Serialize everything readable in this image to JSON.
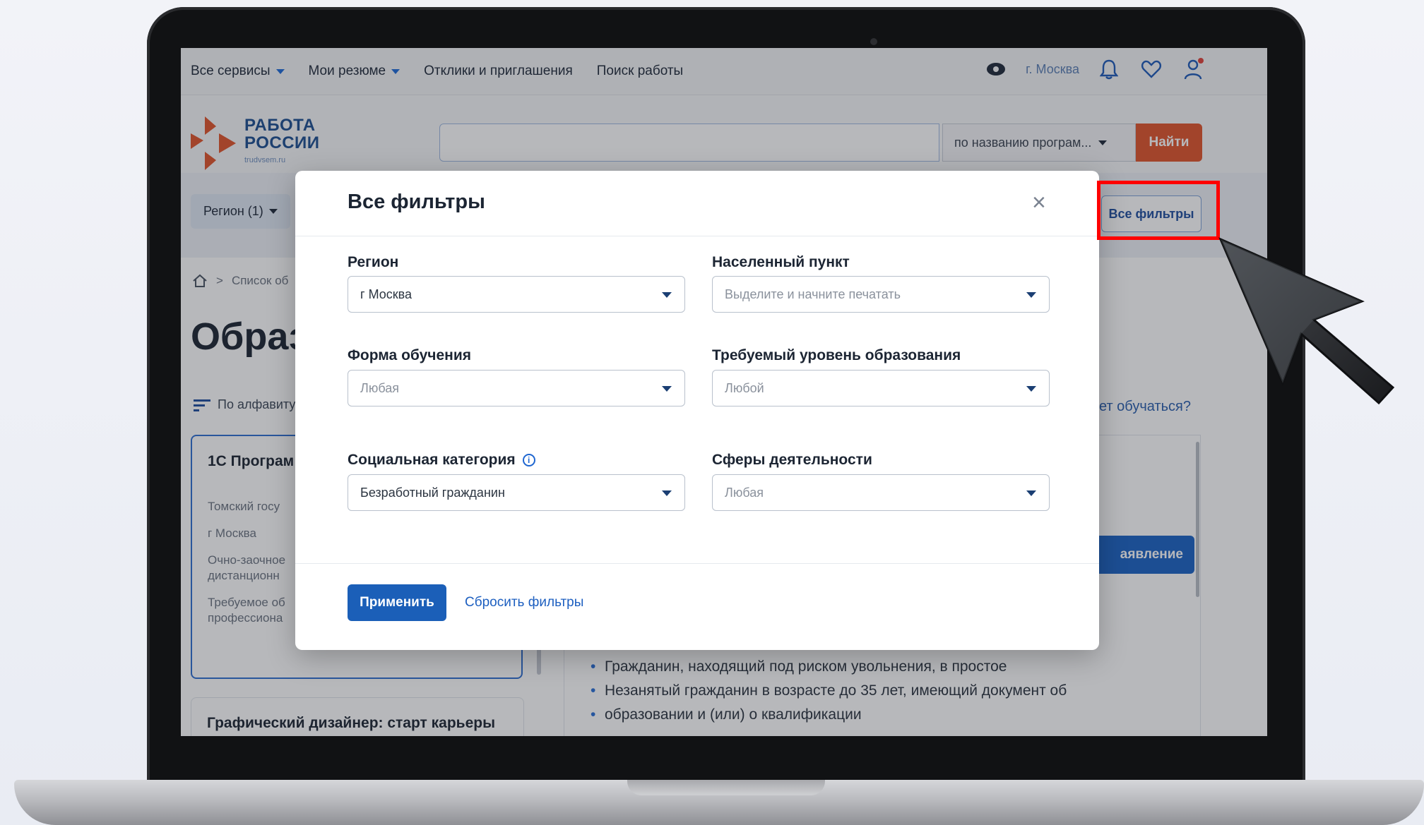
{
  "topbar": {
    "nav": [
      "Все сервисы",
      "Мои резюме",
      "Отклики и приглашения",
      "Поиск работы"
    ],
    "city": "г. Москва"
  },
  "logo": {
    "line1": "РАБОТА",
    "line2": "РОССИИ",
    "domain": "trudvsem.ru"
  },
  "search": {
    "value": "",
    "mode": "по названию програм...",
    "button": "Найти"
  },
  "filters_bar": {
    "region_chip": "Регион (1)",
    "all_filters": "Все фильтры"
  },
  "page": {
    "breadcrumb": "Список об",
    "heading": "Образ",
    "sort": "По алфавиту",
    "question": "ет обучаться?",
    "card1": {
      "title": "1С Програм",
      "lines": [
        "Томский госу",
        "г Москва",
        "Очно-заочное",
        "дистанционн",
        "Требуемое об",
        "профессиона"
      ]
    },
    "card2_title": "Графический дизайнер: старт карьеры",
    "apply_button": "аявление",
    "bullets": [
      "Гражданин, находящий под риском увольнения, в простое",
      "Незанятый гражданин в возрасте до 35 лет, имеющий документ об",
      "образовании и (или) о квалификации"
    ]
  },
  "modal": {
    "title": "Все фильтры",
    "close": "×",
    "fields": {
      "region": {
        "label": "Регион",
        "value": "г Москва"
      },
      "locality": {
        "label": "Населенный пункт",
        "placeholder": "Выделите и начните печатать"
      },
      "study_form": {
        "label": "Форма обучения",
        "placeholder": "Любая"
      },
      "education_level": {
        "label": "Требуемый уровень образования",
        "placeholder": "Любой"
      },
      "social_category": {
        "label": "Социальная категория",
        "value": "Безработный гражданин"
      },
      "activity_areas": {
        "label": "Сферы деятельности",
        "placeholder": "Любая"
      }
    },
    "apply": "Применить",
    "reset": "Сбросить фильтры"
  },
  "colors": {
    "accent": "#1b5fb8",
    "search_button": "#e0552c",
    "highlight": "#ff0000"
  }
}
